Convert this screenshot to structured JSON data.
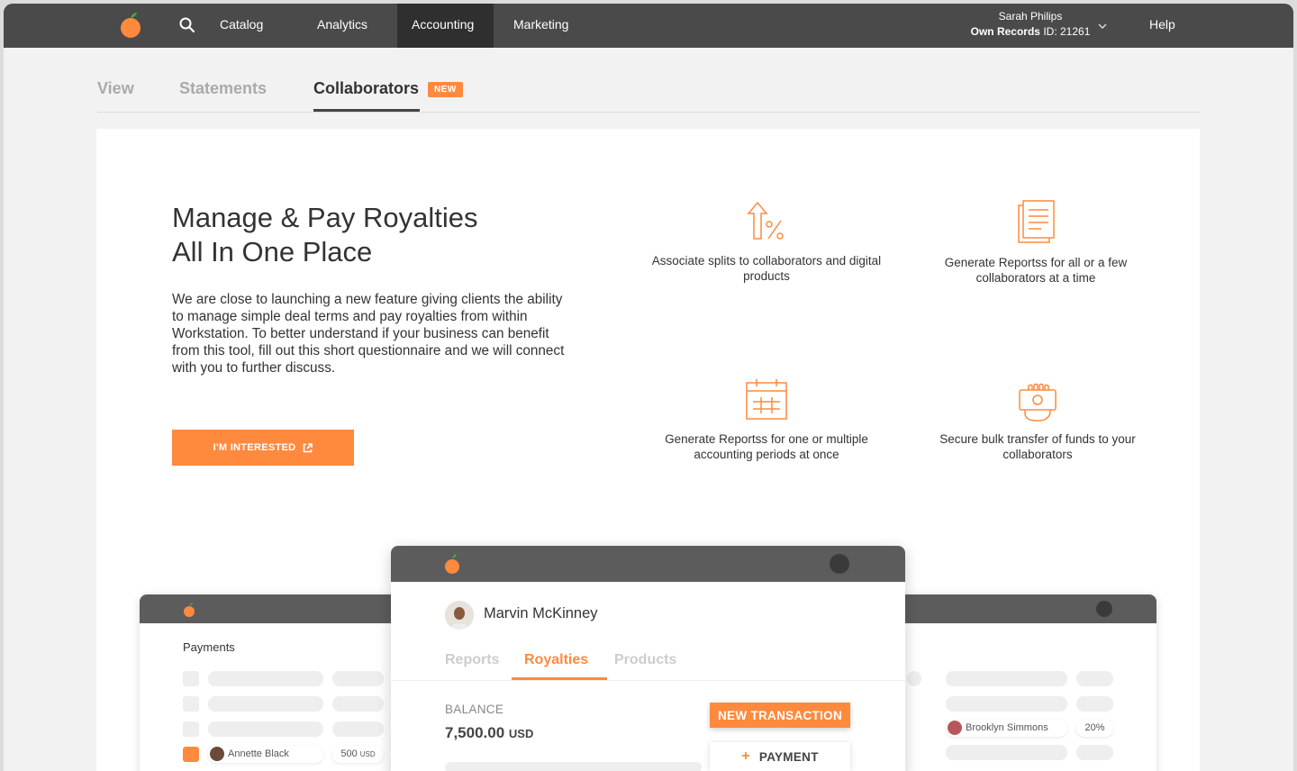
{
  "nav": {
    "items": [
      "Catalog",
      "Analytics",
      "Accounting",
      "Marketing"
    ],
    "active": "Accounting",
    "user_name": "Sarah Philips",
    "user_records_label": "Own Records",
    "user_records_id": "ID: 21261",
    "help": "Help"
  },
  "tabs": {
    "view": "View",
    "statements": "Statements",
    "collaborators": "Collaborators",
    "new_badge": "NEW"
  },
  "hero": {
    "title_line1": "Manage & Pay Royalties",
    "title_line2": "All In One Place",
    "description": "We are close to launching a new feature giving clients the ability to manage simple deal terms and pay royalties from within Workstation. To better understand if your business can benefit from this tool, fill out this short questionnaire and we will connect with you to further discuss.",
    "cta": "I'M INTERESTED"
  },
  "features": [
    {
      "icon": "splits-percent-icon",
      "text": "Associate splits to collaborators and digital products"
    },
    {
      "icon": "document-report-icon",
      "text": "Generate Reportss for all or a few collaborators at a time"
    },
    {
      "icon": "calendar-icon",
      "text": "Generate Reportss for one or multiple accounting periods at once"
    },
    {
      "icon": "hand-money-icon",
      "text": "Secure bulk transfer of funds to your collaborators"
    }
  ],
  "mock_back": {
    "payments_title": "Payments",
    "row_name": "Annette Black",
    "row_amount": "500",
    "row_currency": "USD",
    "right_name": "Brooklyn Simmons",
    "right_pct": "20%"
  },
  "mock_front": {
    "name": "Marvin McKinney",
    "tabs": [
      "Reports",
      "Royalties",
      "Products"
    ],
    "active_tab": "Royalties",
    "balance_label": "BALANCE",
    "balance_value": "7,500.00",
    "balance_currency": "USD",
    "new_transaction": "NEW TRANSACTION",
    "payment": "PAYMENT"
  },
  "colors": {
    "accent": "#ff8a3d",
    "nav_bg": "#4a4a4a",
    "nav_active": "#2f2f2f"
  }
}
